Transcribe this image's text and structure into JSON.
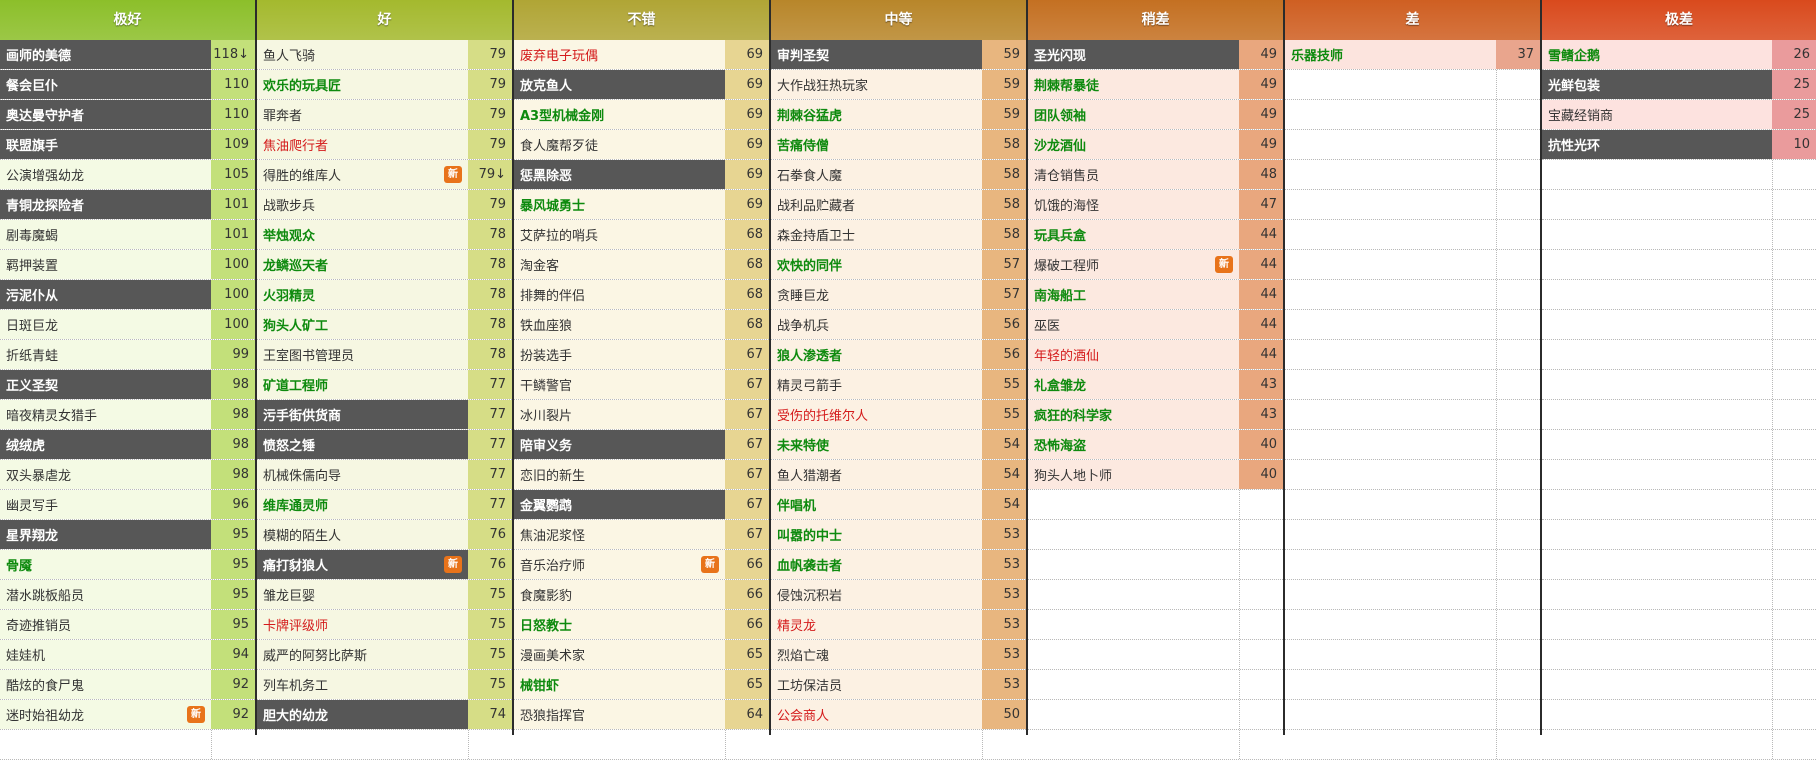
{
  "tiers": [
    {
      "title": "极好",
      "header_color": "#8cbf2a",
      "light_bg": "#f4fae4",
      "score_bg": "#c3e07a",
      "items": [
        {
          "name": "画师的美德",
          "score": "118↓",
          "style": "dark"
        },
        {
          "name": "餐会巨仆",
          "score": "110",
          "style": "dark"
        },
        {
          "name": "奥达曼守护者",
          "score": "110",
          "style": "dark"
        },
        {
          "name": "联盟旗手",
          "score": "109",
          "style": "dark"
        },
        {
          "name": "公演增强幼龙",
          "score": "105",
          "style": "plain"
        },
        {
          "name": "青铜龙探险者",
          "score": "101",
          "style": "dark"
        },
        {
          "name": "剧毒魔蝎",
          "score": "101",
          "style": "plain"
        },
        {
          "name": "羁押装置",
          "score": "100",
          "style": "plain"
        },
        {
          "name": "污泥仆从",
          "score": "100",
          "style": "dark"
        },
        {
          "name": "日斑巨龙",
          "score": "100",
          "style": "plain"
        },
        {
          "name": "折纸青蛙",
          "score": "99",
          "style": "plain"
        },
        {
          "name": "正义圣契",
          "score": "98",
          "style": "dark"
        },
        {
          "name": "暗夜精灵女猎手",
          "score": "98",
          "style": "plain"
        },
        {
          "name": "绒绒虎",
          "score": "98",
          "style": "dark"
        },
        {
          "name": "双头暴虐龙",
          "score": "98",
          "style": "plain"
        },
        {
          "name": "幽灵写手",
          "score": "96",
          "style": "plain"
        },
        {
          "name": "星界翔龙",
          "score": "95",
          "style": "dark"
        },
        {
          "name": "骨魇",
          "score": "95",
          "style": "green"
        },
        {
          "name": "潜水跳板船员",
          "score": "95",
          "style": "plain"
        },
        {
          "name": "奇迹推销员",
          "score": "95",
          "style": "plain"
        },
        {
          "name": "娃娃机",
          "score": "94",
          "style": "plain"
        },
        {
          "name": "酷炫的食尸鬼",
          "score": "92",
          "style": "plain"
        },
        {
          "name": "迷时始祖幼龙",
          "score": "92",
          "style": "plain",
          "badge": "新"
        }
      ]
    },
    {
      "title": "好",
      "header_color": "#a4b92e",
      "light_bg": "#f6f7e2",
      "score_bg": "#d6dd86",
      "items": [
        {
          "name": "鱼人飞骑",
          "score": "79",
          "style": "plain"
        },
        {
          "name": "欢乐的玩具匠",
          "score": "79",
          "style": "green"
        },
        {
          "name": "罪奔者",
          "score": "79",
          "style": "plain"
        },
        {
          "name": "焦油爬行者",
          "score": "79",
          "style": "red"
        },
        {
          "name": "得胜的维库人",
          "score": "79↓",
          "style": "plain",
          "badge": "新"
        },
        {
          "name": "战歌步兵",
          "score": "79",
          "style": "plain"
        },
        {
          "name": "举烛观众",
          "score": "78",
          "style": "green"
        },
        {
          "name": "龙鳞巡天者",
          "score": "78",
          "style": "green"
        },
        {
          "name": "火羽精灵",
          "score": "78",
          "style": "green"
        },
        {
          "name": "狗头人矿工",
          "score": "78",
          "style": "green"
        },
        {
          "name": "王室图书管理员",
          "score": "78",
          "style": "plain"
        },
        {
          "name": "矿道工程师",
          "score": "77",
          "style": "green"
        },
        {
          "name": "污手街供货商",
          "score": "77",
          "style": "dark"
        },
        {
          "name": "愤怒之锤",
          "score": "77",
          "style": "dark"
        },
        {
          "name": "机械侏儒向导",
          "score": "77",
          "style": "plain"
        },
        {
          "name": "维库通灵师",
          "score": "77",
          "style": "green"
        },
        {
          "name": "模糊的陌生人",
          "score": "76",
          "style": "plain"
        },
        {
          "name": "痛打豺狼人",
          "score": "76",
          "style": "dark",
          "badge": "新"
        },
        {
          "name": "雏龙巨婴",
          "score": "75",
          "style": "plain"
        },
        {
          "name": "卡牌评级师",
          "score": "75",
          "style": "red"
        },
        {
          "name": "威严的阿努比萨斯",
          "score": "75",
          "style": "plain"
        },
        {
          "name": "列车机务工",
          "score": "75",
          "style": "plain"
        },
        {
          "name": "胆大的幼龙",
          "score": "74",
          "style": "dark"
        }
      ]
    },
    {
      "title": "不错",
      "header_color": "#b0a535",
      "light_bg": "#fbf6e4",
      "score_bg": "#e7d592",
      "items": [
        {
          "name": "废弃电子玩偶",
          "score": "69",
          "style": "red"
        },
        {
          "name": "放克鱼人",
          "score": "69",
          "style": "dark"
        },
        {
          "name": "A3型机械金刚",
          "score": "69",
          "style": "green"
        },
        {
          "name": "食人魔帮歹徒",
          "score": "69",
          "style": "plain"
        },
        {
          "name": "惩黑除恶",
          "score": "69",
          "style": "dark"
        },
        {
          "name": "暴风城勇士",
          "score": "69",
          "style": "green"
        },
        {
          "name": "艾萨拉的哨兵",
          "score": "68",
          "style": "plain"
        },
        {
          "name": "淘金客",
          "score": "68",
          "style": "plain"
        },
        {
          "name": "排舞的伴侣",
          "score": "68",
          "style": "plain"
        },
        {
          "name": "铁血座狼",
          "score": "68",
          "style": "plain"
        },
        {
          "name": "扮装选手",
          "score": "67",
          "style": "plain"
        },
        {
          "name": "干鳞警官",
          "score": "67",
          "style": "plain"
        },
        {
          "name": "冰川裂片",
          "score": "67",
          "style": "plain"
        },
        {
          "name": "陪审义务",
          "score": "67",
          "style": "dark"
        },
        {
          "name": "恋旧的新生",
          "score": "67",
          "style": "plain"
        },
        {
          "name": "金翼鹦鹉",
          "score": "67",
          "style": "dark"
        },
        {
          "name": "焦油泥浆怪",
          "score": "67",
          "style": "plain"
        },
        {
          "name": "音乐治疗师",
          "score": "66",
          "style": "plain",
          "badge": "新"
        },
        {
          "name": "食魔影豹",
          "score": "66",
          "style": "plain"
        },
        {
          "name": "日怒教士",
          "score": "66",
          "style": "green"
        },
        {
          "name": "漫画美术家",
          "score": "65",
          "style": "plain"
        },
        {
          "name": "械钳虾",
          "score": "65",
          "style": "green"
        },
        {
          "name": "恐狼指挥官",
          "score": "64",
          "style": "plain"
        }
      ]
    },
    {
      "title": "中等",
      "header_color": "#b8862a",
      "light_bg": "#fcf1e3",
      "score_bg": "#e8b67f",
      "items": [
        {
          "name": "审判圣契",
          "score": "59",
          "style": "dark"
        },
        {
          "name": "大作战狂热玩家",
          "score": "59",
          "style": "plain"
        },
        {
          "name": "荆棘谷猛虎",
          "score": "59",
          "style": "green"
        },
        {
          "name": "苦痛侍僧",
          "score": "58",
          "style": "green"
        },
        {
          "name": "石拳食人魔",
          "score": "58",
          "style": "plain"
        },
        {
          "name": "战利品贮藏者",
          "score": "58",
          "style": "plain"
        },
        {
          "name": "森金持盾卫士",
          "score": "58",
          "style": "plain"
        },
        {
          "name": "欢快的同伴",
          "score": "57",
          "style": "green"
        },
        {
          "name": "贪睡巨龙",
          "score": "57",
          "style": "plain"
        },
        {
          "name": "战争机兵",
          "score": "56",
          "style": "plain"
        },
        {
          "name": "狼人渗透者",
          "score": "56",
          "style": "green"
        },
        {
          "name": "精灵弓箭手",
          "score": "55",
          "style": "plain"
        },
        {
          "name": "受伤的托维尔人",
          "score": "55",
          "style": "red"
        },
        {
          "name": "未来特使",
          "score": "54",
          "style": "green"
        },
        {
          "name": "鱼人猎潮者",
          "score": "54",
          "style": "plain"
        },
        {
          "name": "伴唱机",
          "score": "54",
          "style": "green"
        },
        {
          "name": "叫嚣的中士",
          "score": "53",
          "style": "green"
        },
        {
          "name": "血帆袭击者",
          "score": "53",
          "style": "green"
        },
        {
          "name": "侵蚀沉积岩",
          "score": "53",
          "style": "plain"
        },
        {
          "name": "精灵龙",
          "score": "53",
          "style": "red"
        },
        {
          "name": "烈焰亡魂",
          "score": "53",
          "style": "plain"
        },
        {
          "name": "工坊保洁员",
          "score": "53",
          "style": "plain"
        },
        {
          "name": "公会商人",
          "score": "50",
          "style": "red"
        }
      ]
    },
    {
      "title": "稍差",
      "header_color": "#c47022",
      "light_bg": "#fce9e0",
      "score_bg": "#e9a77e",
      "items": [
        {
          "name": "圣光闪现",
          "score": "49",
          "style": "dark"
        },
        {
          "name": "荆棘帮暴徒",
          "score": "49",
          "style": "green"
        },
        {
          "name": "团队领袖",
          "score": "49",
          "style": "green"
        },
        {
          "name": "沙龙酒仙",
          "score": "49",
          "style": "green"
        },
        {
          "name": "清仓销售员",
          "score": "48",
          "style": "plain"
        },
        {
          "name": "饥饿的海怪",
          "score": "47",
          "style": "plain"
        },
        {
          "name": "玩具兵盒",
          "score": "44",
          "style": "green"
        },
        {
          "name": "爆破工程师",
          "score": "44",
          "style": "plain",
          "badge": "新"
        },
        {
          "name": "南海船工",
          "score": "44",
          "style": "green"
        },
        {
          "name": "巫医",
          "score": "44",
          "style": "plain"
        },
        {
          "name": "年轻的酒仙",
          "score": "44",
          "style": "red"
        },
        {
          "name": "礼盒雏龙",
          "score": "43",
          "style": "green"
        },
        {
          "name": "疯狂的科学家",
          "score": "43",
          "style": "green"
        },
        {
          "name": "恐怖海盗",
          "score": "40",
          "style": "green"
        },
        {
          "name": "狗头人地卜师",
          "score": "40",
          "style": "plain"
        }
      ]
    },
    {
      "title": "差",
      "header_color": "#cf5f22",
      "light_bg": "#fce4de",
      "score_bg": "#e9a58d",
      "items": [
        {
          "name": "乐器技师",
          "score": "37",
          "style": "green"
        }
      ]
    },
    {
      "title": "极差",
      "header_color": "#d94a1d",
      "light_bg": "#fde2df",
      "score_bg": "#ea9b9c",
      "items": [
        {
          "name": "雪鳍企鹅",
          "score": "26",
          "style": "green"
        },
        {
          "name": "光鲜包装",
          "score": "25",
          "style": "dark"
        },
        {
          "name": "宝藏经销商",
          "score": "25",
          "style": "plain"
        },
        {
          "name": "抗性光环",
          "score": "10",
          "style": "dark"
        }
      ]
    }
  ]
}
